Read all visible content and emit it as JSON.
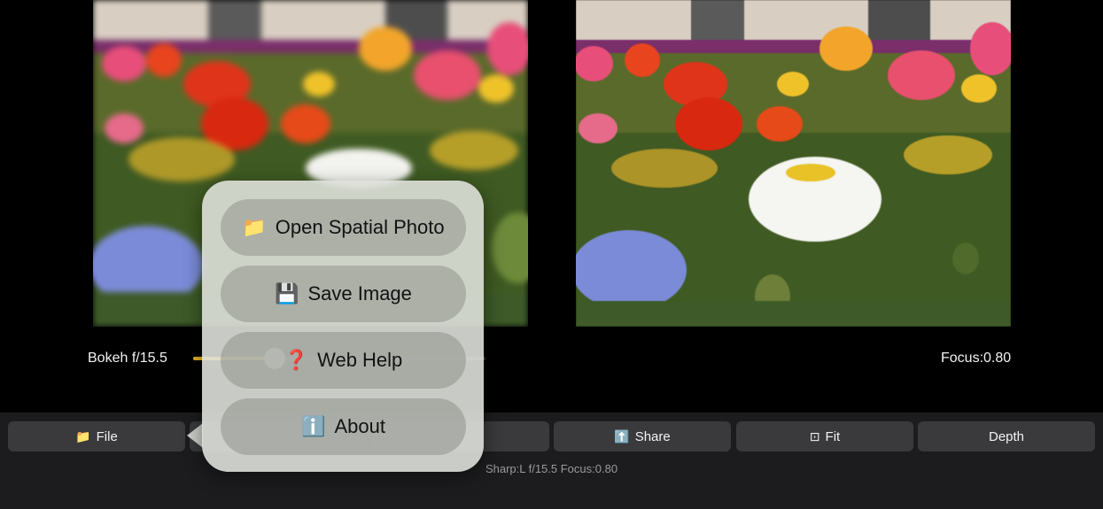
{
  "controls": {
    "bokeh_label": "Bokeh f/15.5",
    "bokeh_slider_value": 0.28,
    "focus_label": "Focus:0.80",
    "accent_color": "#e7b322"
  },
  "toolbar": {
    "file": {
      "icon": "folder-icon",
      "glyph": "📁",
      "label": "File"
    },
    "share": {
      "icon": "share-icon",
      "glyph": "⬆️",
      "label": "Share"
    },
    "fit": {
      "icon": "fit-icon",
      "glyph": "⊡",
      "label": "Fit"
    },
    "depth": {
      "label": "Depth"
    }
  },
  "status": "Sharp:L  f/15.5  Focus:0.80",
  "file_menu": {
    "items": [
      {
        "icon": "folder-icon",
        "glyph": "📁",
        "label": "Open Spatial Photo"
      },
      {
        "icon": "floppy-disk-icon",
        "glyph": "💾",
        "label": "Save Image"
      },
      {
        "icon": "question-icon",
        "glyph": "❓",
        "label": "Web Help"
      },
      {
        "icon": "info-icon",
        "glyph": "ℹ️",
        "label": "About"
      }
    ]
  }
}
